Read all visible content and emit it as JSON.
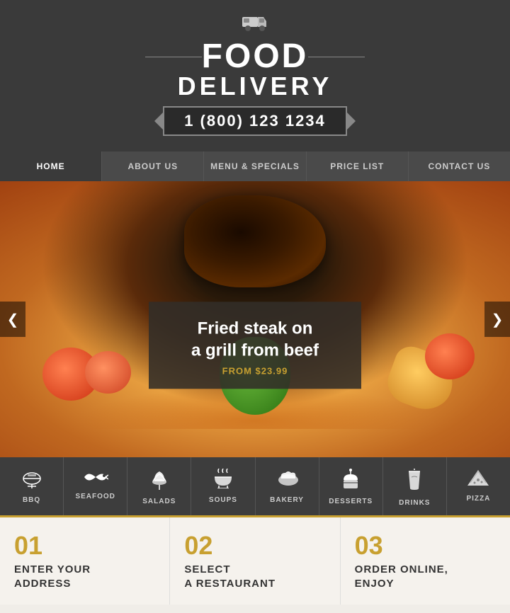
{
  "header": {
    "truck_icon": "🚚",
    "title_food": "FOOD",
    "title_delivery": "DELIVERY",
    "phone": "1 (800) 123 1234"
  },
  "nav": {
    "items": [
      {
        "label": "HOME",
        "active": true
      },
      {
        "label": "ABOUT US",
        "active": false
      },
      {
        "label": "MENU & SPECIALS",
        "active": false
      },
      {
        "label": "PRICE LIST",
        "active": false
      },
      {
        "label": "CONTACT US",
        "active": false
      }
    ]
  },
  "hero": {
    "title_line1": "Fried steak on",
    "title_line2": "a grill from beef",
    "price": "FROM $23.99",
    "prev_label": "❮",
    "next_label": "❯"
  },
  "categories": [
    {
      "icon": "🍖",
      "label": "BBQ"
    },
    {
      "icon": "🐟",
      "label": "SEAFOOD"
    },
    {
      "icon": "🥗",
      "label": "SALADS"
    },
    {
      "icon": "🍲",
      "label": "SOUPS"
    },
    {
      "icon": "🥐",
      "label": "BAKERY"
    },
    {
      "icon": "🍰",
      "label": "DESSERTS"
    },
    {
      "icon": "🍹",
      "label": "DRINKS"
    },
    {
      "icon": "🍕",
      "label": "PIZZA"
    }
  ],
  "steps": [
    {
      "number": "01",
      "text_line1": "ENTER YOUR",
      "text_line2": "ADDRESS"
    },
    {
      "number": "02",
      "text_line1": "SELECT",
      "text_line2": "A RESTAURANT"
    },
    {
      "number": "03",
      "text_line1": "ORDER ONLINE,",
      "text_line2": "ENJOY"
    }
  ]
}
